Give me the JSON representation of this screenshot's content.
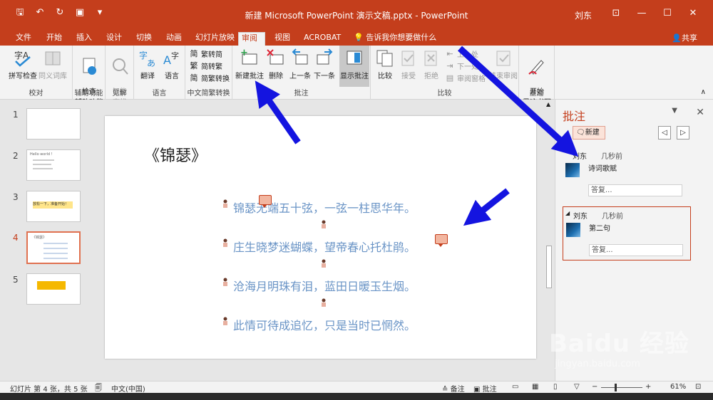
{
  "titlebar": {
    "title": "新建 Microsoft PowerPoint 演示文稿.pptx  -  PowerPoint",
    "user": "刘东",
    "accent": "#c43e1c"
  },
  "tabs": [
    "文件",
    "开始",
    "插入",
    "设计",
    "切换",
    "动画",
    "幻灯片放映",
    "审阅",
    "视图",
    "ACROBAT"
  ],
  "active_tab": "审阅",
  "tell_me": "告诉我你想要做什么",
  "share": "共享",
  "ribbon": {
    "groups": {
      "proofing": {
        "label": "校对",
        "spell": "拼写检查",
        "thesaurus": "同义词库"
      },
      "accessibility": {
        "label": "辅助功能",
        "check": "检查\n辅助功能"
      },
      "insights": {
        "label": "见解",
        "smart": "智能\n查找"
      },
      "language": {
        "label": "语言",
        "translate": "翻译",
        "language": "语言"
      },
      "chinese": {
        "label": "中文简繁转换",
        "t2s": "繁转简",
        "s2t": "简转繁",
        "convert": "简繁转换"
      },
      "comments": {
        "label": "批注",
        "new": "新建批注",
        "delete": "删除",
        "prev": "上一条",
        "next": "下一条",
        "show": "显示批注"
      },
      "compare": {
        "label": "比较",
        "compare": "比较",
        "accept": "接受",
        "reject": "拒绝",
        "prev": "上一处",
        "next": "下一处",
        "pane": "审阅窗格",
        "end": "结束审阅"
      },
      "ink": {
        "label": "墨迹",
        "start": "开始\n墨迹书写"
      }
    }
  },
  "slides": [
    {
      "num": "1"
    },
    {
      "num": "2",
      "thumb_text": "Hello world !"
    },
    {
      "num": "3",
      "thumb_text": "放松一下，准备开始！"
    },
    {
      "num": "4",
      "thumb_text": "《锦瑟》"
    },
    {
      "num": "5"
    }
  ],
  "selected_slide": "4",
  "slide": {
    "title": "《锦瑟》",
    "lines": [
      "锦瑟无端五十弦，一弦一柱思华年。",
      "庄生晓梦迷蝴蝶，望帝春心托杜鹃。",
      "沧海月明珠有泪，蓝田日暖玉生烟。",
      "此情可待成追忆，只是当时已惘然。"
    ]
  },
  "comments_pane": {
    "title": "批注",
    "new_label": "新建",
    "comments": [
      {
        "author": "刘东",
        "time": "几秒前",
        "text": "诗词歌赋",
        "reply_placeholder": "答复..."
      },
      {
        "author": "刘东",
        "time": "几秒前",
        "text": "第二句",
        "reply_placeholder": "答复..."
      }
    ]
  },
  "status": {
    "slide_info": "幻灯片 第 4 张，共 5 张",
    "language": "中文(中国)",
    "notes": "备注",
    "comments": "批注",
    "zoom": "61%"
  },
  "watermark": {
    "big": "Baidu 经验",
    "small": "jingyan.baidu.com"
  }
}
